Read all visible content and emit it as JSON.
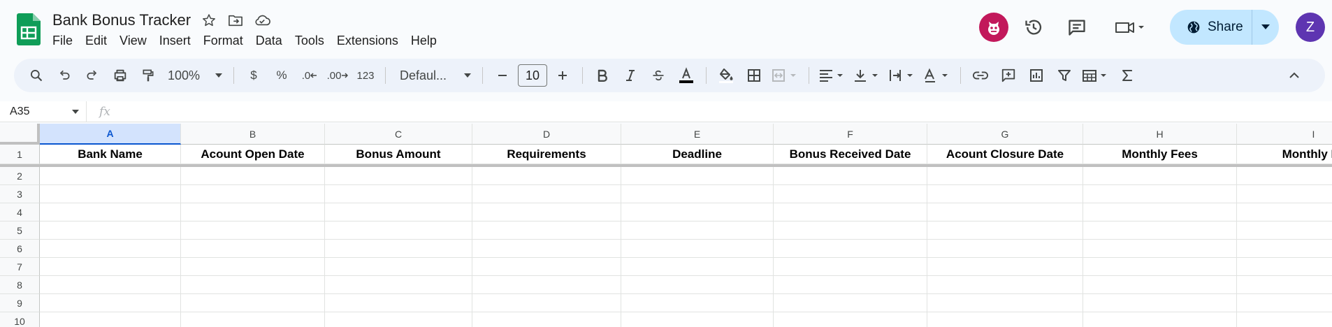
{
  "app": {
    "doc_title": "Bank Bonus Tracker",
    "menu": [
      "File",
      "Edit",
      "View",
      "Insert",
      "Format",
      "Data",
      "Tools",
      "Extensions",
      "Help"
    ],
    "share_label": "Share",
    "user_initial": "Z"
  },
  "toolbar": {
    "zoom": "100%",
    "currency": "$",
    "percent": "%",
    "decrease_decimal": ".0",
    "increase_decimal": ".00",
    "number_format": "123",
    "font": "Defaul...",
    "font_size": "10"
  },
  "formula_bar": {
    "cell_ref": "A35",
    "fx": "fx"
  },
  "sheet": {
    "columns": [
      "A",
      "B",
      "C",
      "D",
      "E",
      "F",
      "G",
      "H",
      "I"
    ],
    "rows": [
      "1",
      "2",
      "3",
      "4",
      "5",
      "6",
      "7",
      "8",
      "9",
      "10"
    ],
    "headers": [
      "Bank Name",
      "Acount Open Date",
      "Bonus Amount",
      "Requirements",
      "Deadline",
      "Bonus Received Date",
      "Acount Closure Date",
      "Monthly Fees",
      "Monthly Fe"
    ]
  },
  "colors": {
    "accent": "#0b57d0",
    "share_bg": "#c2e7ff",
    "sheets_green": "#0f9d58",
    "avatar_bot": "#c2185b",
    "avatar_user": "#5e35b1"
  }
}
